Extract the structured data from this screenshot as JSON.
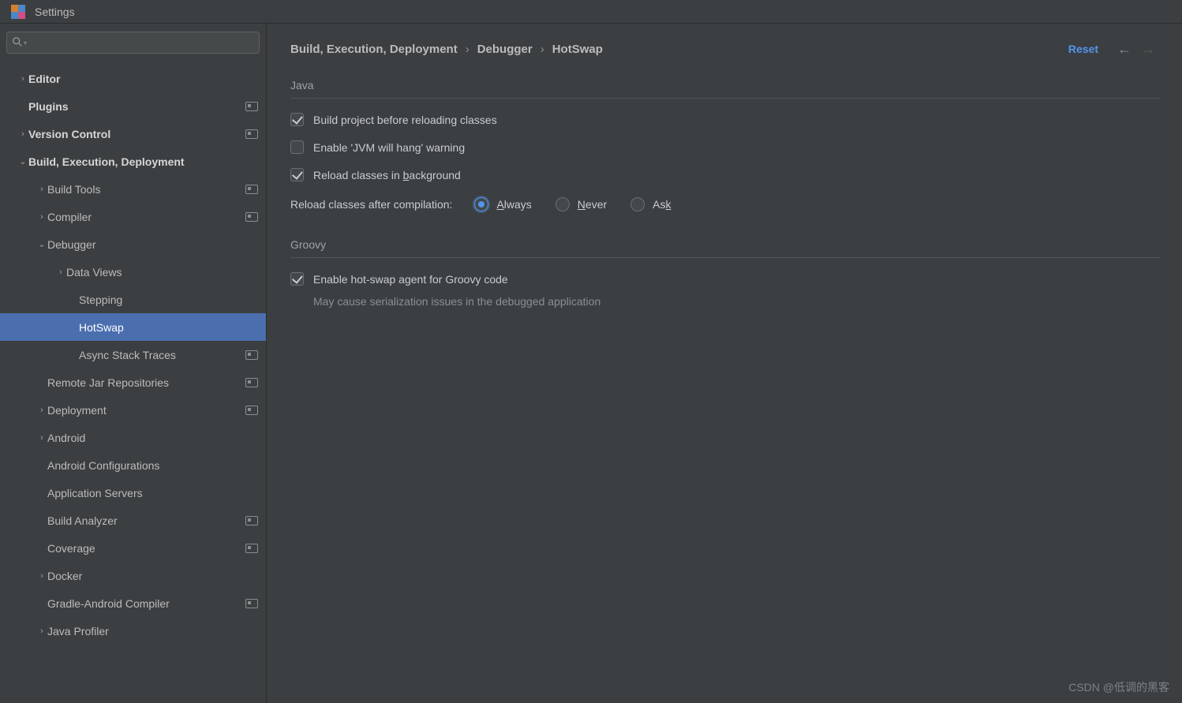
{
  "window": {
    "title": "Settings"
  },
  "sidebar": {
    "search_placeholder": "",
    "items": [
      {
        "label": "Editor",
        "depth": 0,
        "arrow": "right",
        "bold": true,
        "proj": false
      },
      {
        "label": "Plugins",
        "depth": 0,
        "arrow": "none",
        "bold": true,
        "proj": true
      },
      {
        "label": "Version Control",
        "depth": 0,
        "arrow": "right",
        "bold": true,
        "proj": true
      },
      {
        "label": "Build, Execution, Deployment",
        "depth": 0,
        "arrow": "down",
        "bold": true,
        "proj": false
      },
      {
        "label": "Build Tools",
        "depth": 1,
        "arrow": "right",
        "bold": false,
        "proj": true
      },
      {
        "label": "Compiler",
        "depth": 1,
        "arrow": "right",
        "bold": false,
        "proj": true
      },
      {
        "label": "Debugger",
        "depth": 1,
        "arrow": "down",
        "bold": false,
        "proj": false
      },
      {
        "label": "Data Views",
        "depth": 2,
        "arrow": "right",
        "bold": false,
        "proj": false
      },
      {
        "label": "Stepping",
        "depth": 3,
        "arrow": "none",
        "bold": false,
        "proj": false
      },
      {
        "label": "HotSwap",
        "depth": 3,
        "arrow": "none",
        "bold": false,
        "proj": false,
        "selected": true
      },
      {
        "label": "Async Stack Traces",
        "depth": 3,
        "arrow": "none",
        "bold": false,
        "proj": true
      },
      {
        "label": "Remote Jar Repositories",
        "depth": 1,
        "arrow": "none",
        "bold": false,
        "proj": true
      },
      {
        "label": "Deployment",
        "depth": 1,
        "arrow": "right",
        "bold": false,
        "proj": true
      },
      {
        "label": "Android",
        "depth": 1,
        "arrow": "right",
        "bold": false,
        "proj": false
      },
      {
        "label": "Android Configurations",
        "depth": 1,
        "arrow": "none",
        "bold": false,
        "proj": false
      },
      {
        "label": "Application Servers",
        "depth": 1,
        "arrow": "none",
        "bold": false,
        "proj": false
      },
      {
        "label": "Build Analyzer",
        "depth": 1,
        "arrow": "none",
        "bold": false,
        "proj": true
      },
      {
        "label": "Coverage",
        "depth": 1,
        "arrow": "none",
        "bold": false,
        "proj": true
      },
      {
        "label": "Docker",
        "depth": 1,
        "arrow": "right",
        "bold": false,
        "proj": false
      },
      {
        "label": "Gradle-Android Compiler",
        "depth": 1,
        "arrow": "none",
        "bold": false,
        "proj": true
      },
      {
        "label": "Java Profiler",
        "depth": 1,
        "arrow": "right",
        "bold": false,
        "proj": false
      }
    ]
  },
  "breadcrumb": {
    "segments": [
      "Build, Execution, Deployment",
      "Debugger",
      "HotSwap"
    ],
    "reset": "Reset"
  },
  "java": {
    "title": "Java",
    "opt_build_before": {
      "label": "Build project before reloading classes",
      "checked": true
    },
    "opt_enable_warning": {
      "label": "Enable 'JVM will hang' warning",
      "checked": false
    },
    "opt_reload_bg_pre": "Reload classes in ",
    "opt_reload_bg_u": "b",
    "opt_reload_bg_post": "ackground",
    "opt_reload_bg_checked": true,
    "reload_after_label": "Reload classes after compilation:",
    "radios": {
      "always": {
        "u": "A",
        "rest": "lways",
        "checked": true
      },
      "never": {
        "u": "N",
        "rest": "ever",
        "checked": false
      },
      "ask": {
        "pre": "As",
        "u": "k",
        "checked": false
      }
    }
  },
  "groovy": {
    "title": "Groovy",
    "opt_enable": {
      "label": "Enable hot-swap agent for Groovy code",
      "checked": true
    },
    "hint": "May cause serialization issues in the debugged application"
  },
  "watermark": "CSDN @低调的黑客"
}
